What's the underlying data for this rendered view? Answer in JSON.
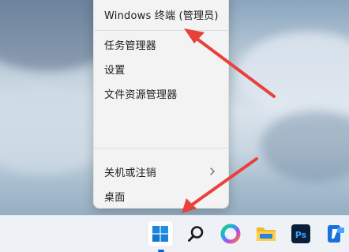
{
  "menu": {
    "items": [
      {
        "label": "Windows 终端 (管理员)"
      },
      {
        "label": "任务管理器"
      },
      {
        "label": "设置"
      },
      {
        "label": "文件资源管理器"
      },
      {
        "label": "关机或注销"
      },
      {
        "label": "桌面"
      }
    ],
    "submenu_indicator": "chevron-right-icon"
  },
  "taskbar": {
    "icons": [
      {
        "name": "windows-start-icon"
      },
      {
        "name": "search-icon"
      },
      {
        "name": "copilot-icon"
      },
      {
        "name": "file-explorer-icon"
      },
      {
        "name": "photoshop-icon",
        "label": "Ps"
      },
      {
        "name": "app-icon"
      }
    ],
    "accent_color": "#0a64d6"
  },
  "annotation": {
    "arrow_color": "#e8413b"
  }
}
